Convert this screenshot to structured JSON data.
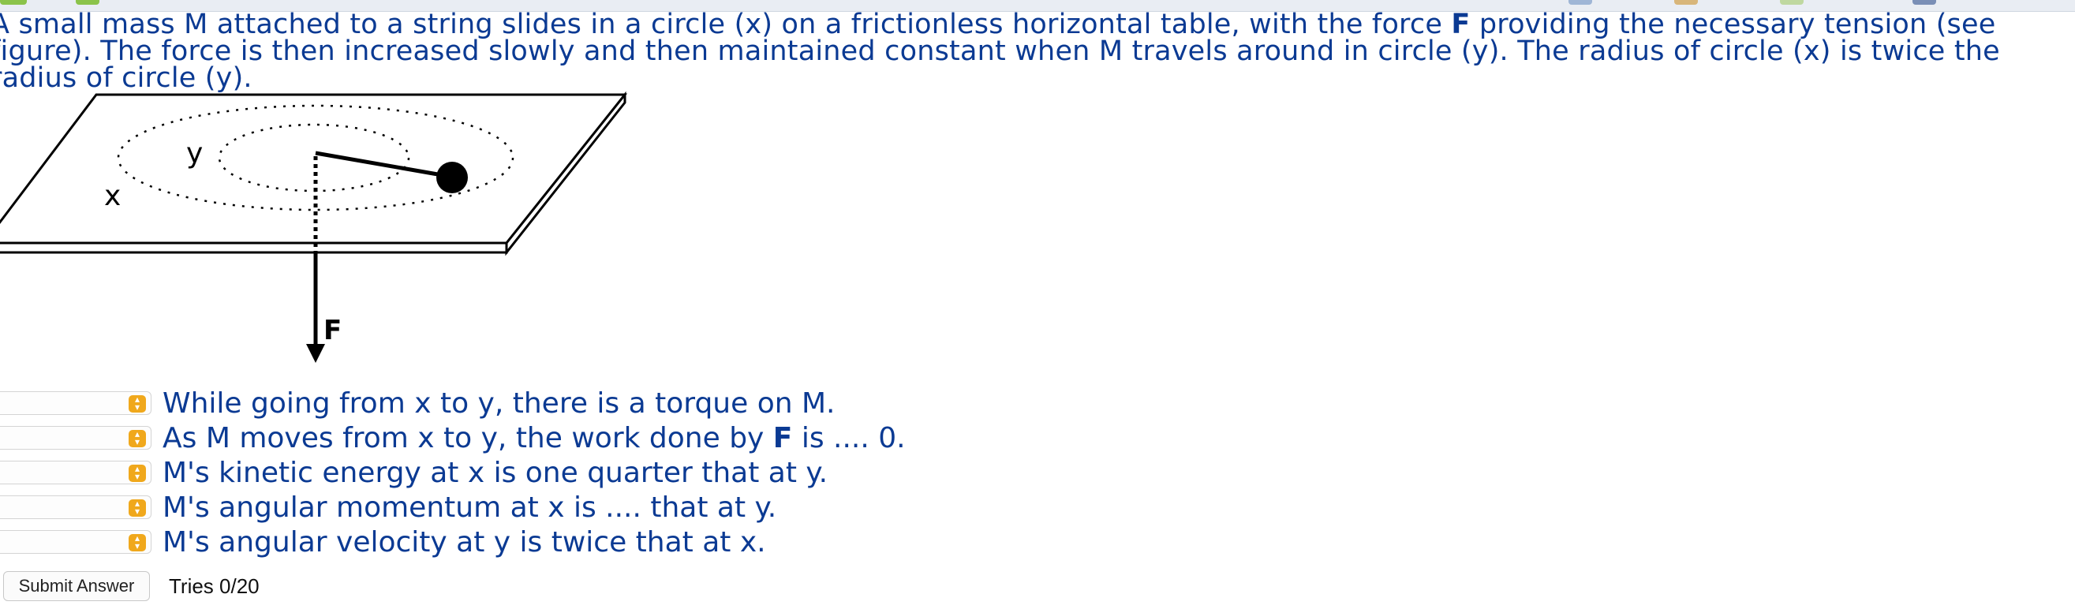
{
  "question": {
    "part1": "A small mass M attached to a string slides in a circle (x) on a frictionless horizontal table, with the force ",
    "force_symbol": "F",
    "part2": " providing the necessary tension (see figure). The force is then increased slowly and then maintained constant when M travels around in circle (y). The radius of circle (x) is twice the radius of circle (y)."
  },
  "figure": {
    "label_x": "x",
    "label_y": "y",
    "label_force": "F"
  },
  "statements": [
    {
      "text": "While going from x to y, there is a torque on M.",
      "selected": ""
    },
    {
      "pre": "As M moves from x to y, the work done by ",
      "bold": "F",
      "post": " is .... 0.",
      "selected": ""
    },
    {
      "text": "M's kinetic energy at x is one quarter that at y.",
      "selected": ""
    },
    {
      "text": "M's angular momentum at x is .... that at y.",
      "selected": ""
    },
    {
      "text": "M's angular velocity at y is twice that at x.",
      "selected": ""
    }
  ],
  "controls": {
    "submit_label": "Submit Answer",
    "tries": "Tries 0/20"
  },
  "colors": {
    "question_text": "#0b3a93",
    "select_arrow": "#f0a81c"
  }
}
